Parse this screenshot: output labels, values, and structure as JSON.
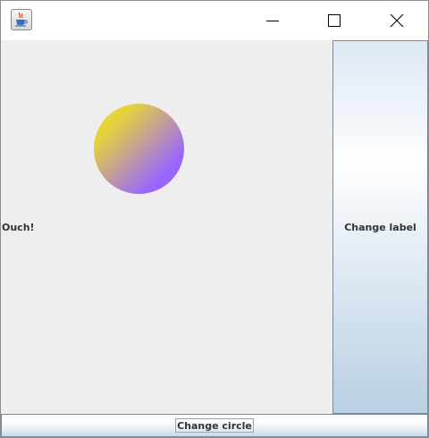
{
  "window": {
    "controls": {
      "minimize_icon": "minimize-icon",
      "maximize_icon": "maximize-icon",
      "close_icon": "close-icon"
    },
    "app_icon": "java-coffee-cup-icon"
  },
  "canvas": {
    "label_text": "Ouch!",
    "circle": {
      "gradient_start": "#e6d23a",
      "gradient_end": "#9966ff"
    },
    "background": "#eeeeee"
  },
  "buttons": {
    "change_label": "Change label",
    "change_circle": "Change circle"
  }
}
